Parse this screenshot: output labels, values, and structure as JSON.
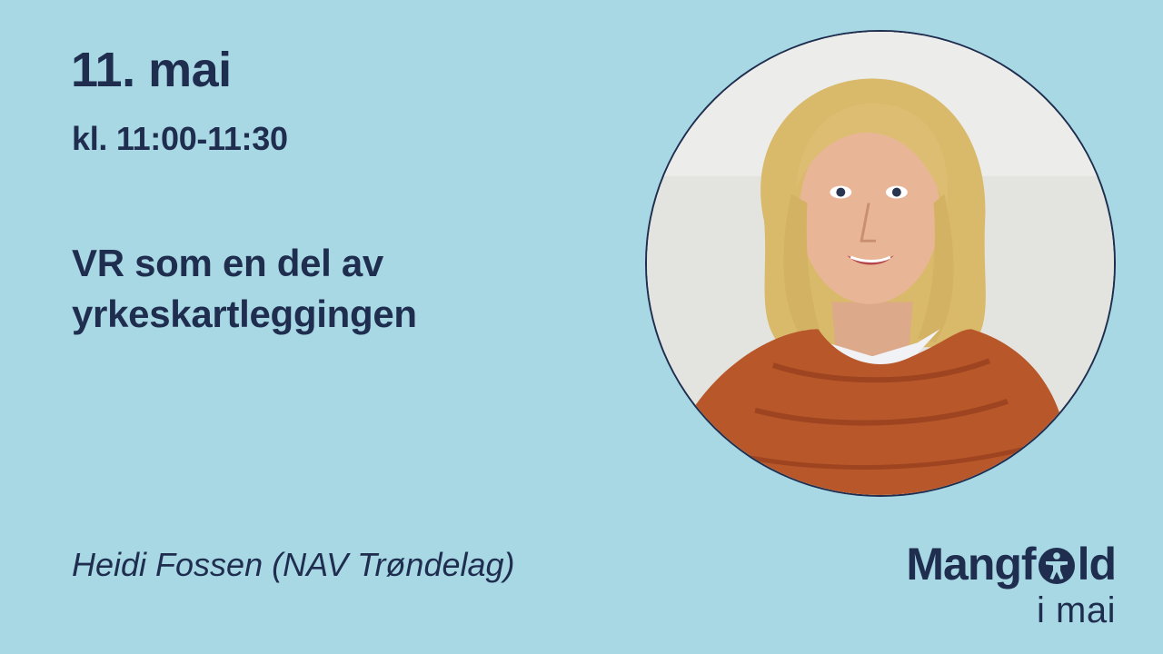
{
  "event": {
    "date": "11. mai",
    "time": "kl. 11:00-11:30",
    "title_line_1": "VR som en del av",
    "title_line_2": "yrkeskartleggingen",
    "speaker": "Heidi Fossen (NAV Trøndelag)"
  },
  "photo": {
    "subject": "portrait of presenter"
  },
  "logo": {
    "word_part_1": "Mangf",
    "word_part_2": "ld",
    "subline": "i mai",
    "icon": "accessibility-person-icon"
  },
  "colors": {
    "background": "#a8d8e4",
    "text": "#1f2d4f",
    "sweater": "#b8582a"
  }
}
